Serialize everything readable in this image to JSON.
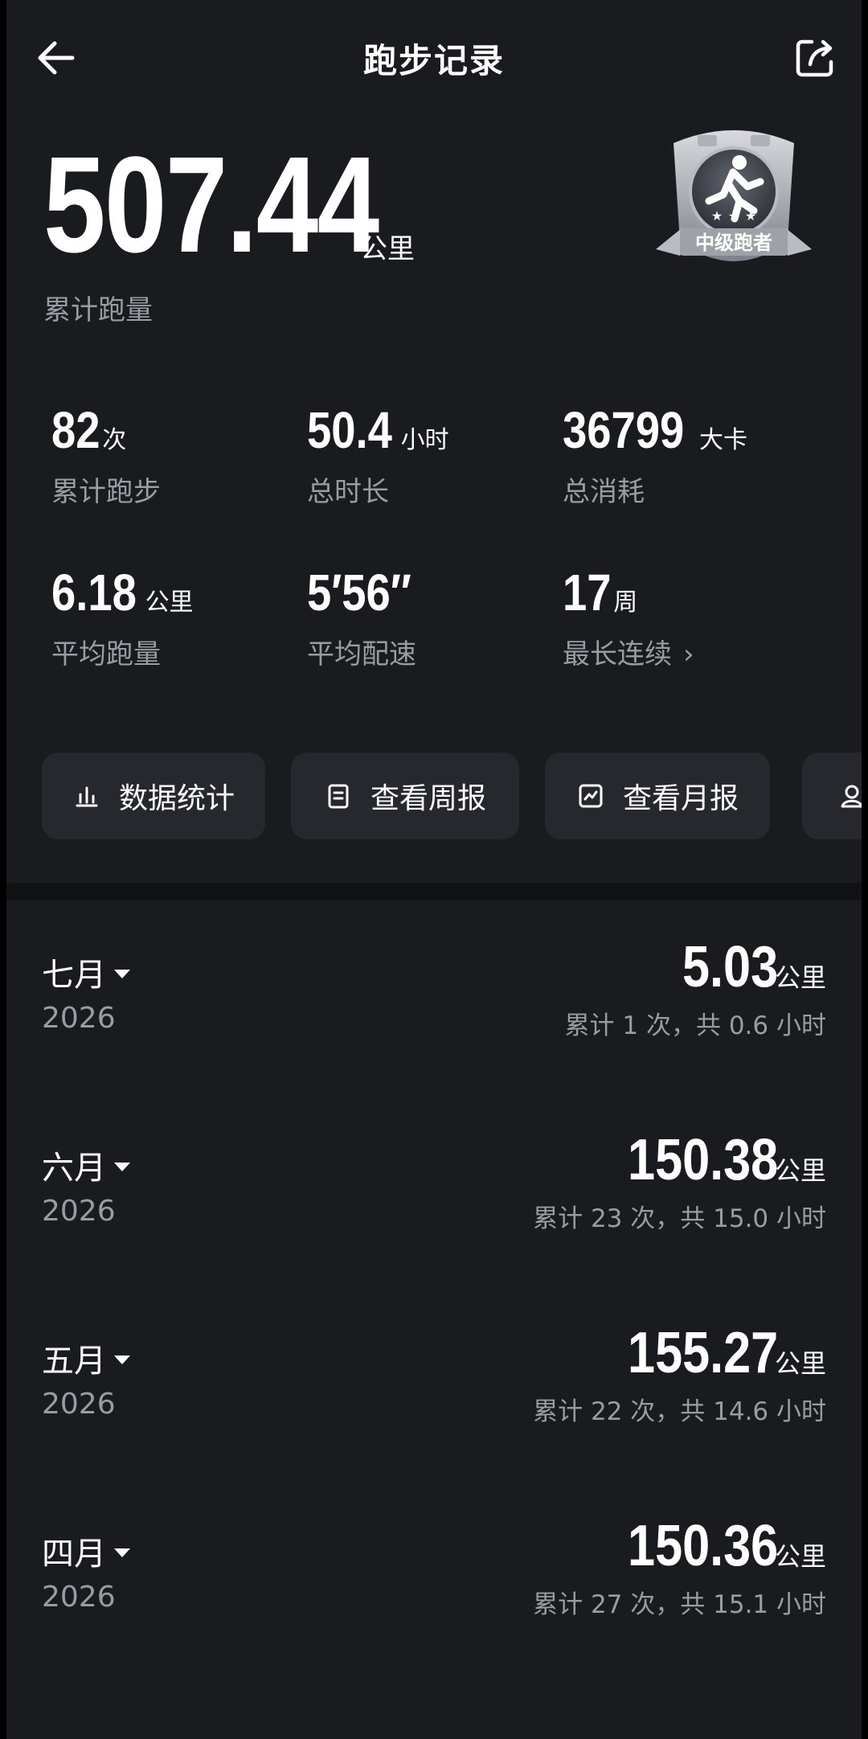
{
  "header": {
    "title": "跑步记录"
  },
  "total": {
    "value": "507.44",
    "unit": "公里",
    "label": "累计跑量"
  },
  "badge": {
    "text": "中级跑者",
    "stars": 3
  },
  "stats": [
    {
      "value": "82",
      "unit": "次",
      "label": "累计跑步"
    },
    {
      "value": "50.4",
      "unit": "小时",
      "label": "总时长"
    },
    {
      "value": "36799",
      "unit": "大卡",
      "label": "总消耗"
    },
    {
      "value": "6.18",
      "unit": "公里",
      "label": "平均跑量"
    },
    {
      "value": "5′56″",
      "unit": "",
      "label": "平均配速"
    },
    {
      "value": "17",
      "unit": "周",
      "label": "最长连续"
    }
  ],
  "actions": [
    {
      "label": "数据统计",
      "icon": "bar-chart-icon"
    },
    {
      "label": "查看周报",
      "icon": "weekly-report-icon"
    },
    {
      "label": "查看月报",
      "icon": "monthly-report-icon"
    },
    {
      "label": "",
      "icon": "profile-icon"
    }
  ],
  "months": [
    {
      "name": "七月",
      "year": "2026",
      "distance": "5.03",
      "unit": "公里",
      "summary": "累计 1 次，共 0.6 小时"
    },
    {
      "name": "六月",
      "year": "2026",
      "distance": "150.38",
      "unit": "公里",
      "summary": "累计 23 次，共 15.0 小时"
    },
    {
      "name": "五月",
      "year": "2026",
      "distance": "155.27",
      "unit": "公里",
      "summary": "累计 22 次，共 14.6 小时"
    },
    {
      "name": "四月",
      "year": "2026",
      "distance": "150.36",
      "unit": "公里",
      "summary": "累计 27 次，共 15.1 小时"
    }
  ],
  "colors": {
    "background": "#1a1b1f",
    "card": "#26282d",
    "muted_text": "#9a9ca3"
  }
}
